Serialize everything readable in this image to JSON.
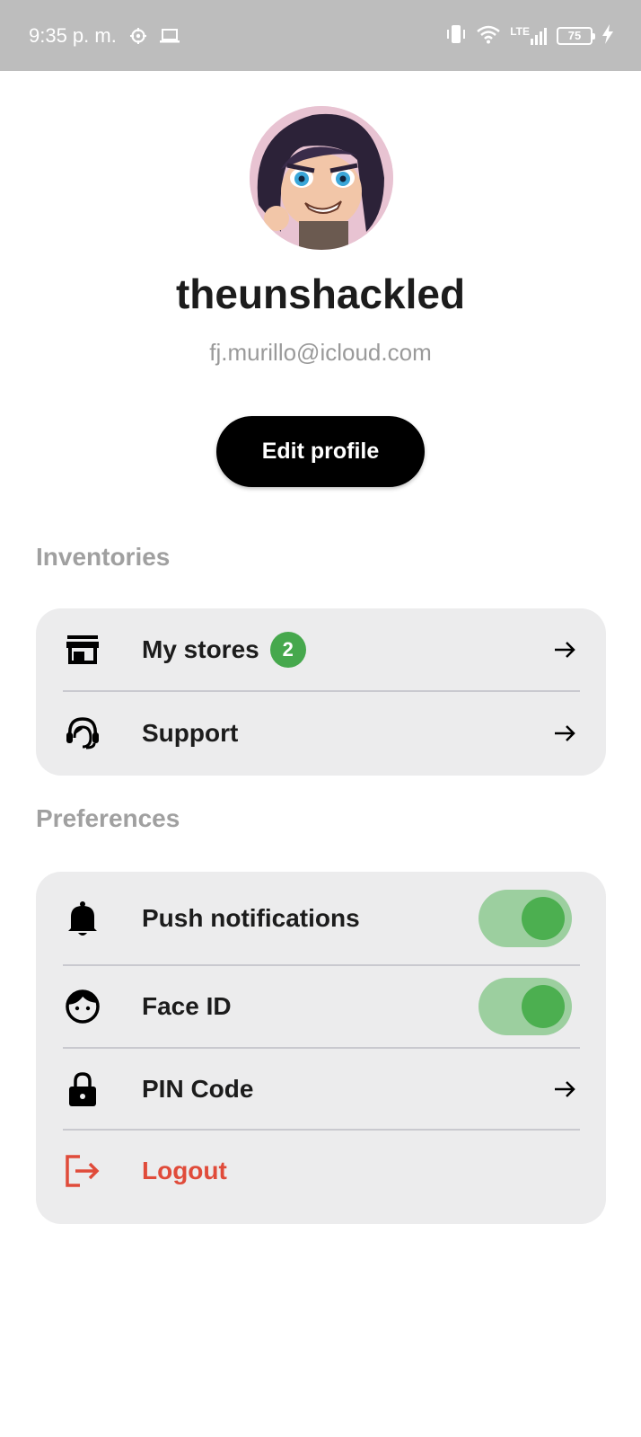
{
  "status_bar": {
    "time": "9:35 p. m.",
    "network": "LTE",
    "battery": "75",
    "icons": [
      "settings-icon",
      "laptop-icon",
      "vibrate-icon",
      "wifi-icon",
      "signal-icon",
      "battery-icon",
      "charging-icon"
    ]
  },
  "profile": {
    "username": "theunshackled",
    "email": "fj.murillo@icloud.com",
    "edit_label": "Edit profile"
  },
  "inventories": {
    "title": "Inventories",
    "items": [
      {
        "label": "My stores",
        "badge": "2",
        "icon": "store-icon"
      },
      {
        "label": "Support",
        "icon": "headset-icon"
      }
    ]
  },
  "preferences": {
    "title": "Preferences",
    "items": [
      {
        "label": "Push notifications",
        "icon": "bell-icon",
        "toggle": true
      },
      {
        "label": "Face ID",
        "icon": "face-icon",
        "toggle": true
      },
      {
        "label": "PIN Code",
        "icon": "lock-icon"
      },
      {
        "label": "Logout",
        "icon": "logout-icon"
      }
    ]
  },
  "colors": {
    "accent_green": "#4caf50",
    "toggle_track": "#9ccf9f",
    "logout_red": "#e04b3a",
    "button_black": "#000000"
  }
}
